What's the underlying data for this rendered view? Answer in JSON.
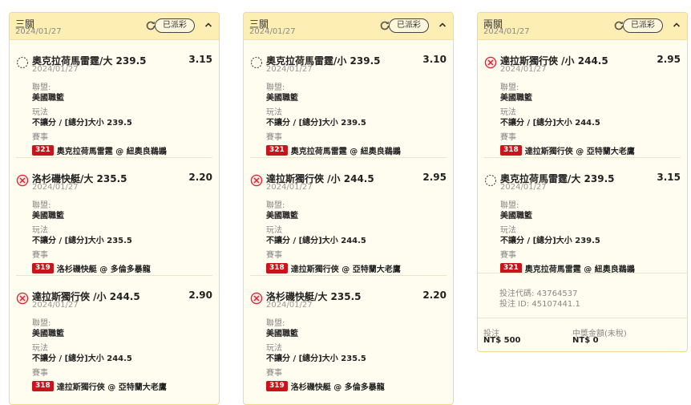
{
  "colors": {
    "accent": "#fdeeb4",
    "border": "#f3d989",
    "badge": "#c8141b",
    "lost": "#d9262b"
  },
  "labels": {
    "league": "聯盟:",
    "play": "玩法",
    "event": "賽事"
  },
  "tickets": [
    {
      "title": "三關",
      "date": "2024/01/27",
      "status": "已派彩",
      "legs": [
        {
          "result": "pending",
          "selection": "奧克拉荷馬雷霆/大 239.5",
          "odds": "3.15",
          "date": "2024/01/27",
          "league": "美國職籃",
          "play": "不讓分 / [總分]大小 239.5",
          "event_id": "321",
          "event_name": "奧克拉荷馬雷霆 @ 紐奧良鵜鶘"
        },
        {
          "result": "lost",
          "selection": "洛杉磯快艇/大 235.5",
          "odds": "2.20",
          "date": "2024/01/27",
          "league": "美國職籃",
          "play": "不讓分 / [總分]大小 235.5",
          "event_id": "319",
          "event_name": "洛杉磯快艇 @ 多倫多暴龍"
        },
        {
          "result": "lost",
          "selection": "達拉斯獨行俠 /小 244.5",
          "odds": "2.90",
          "date": "2024/01/27",
          "league": "美國職籃",
          "play": "不讓分 / [總分]大小 244.5",
          "event_id": "318",
          "event_name": "達拉斯獨行俠 @ 亞特蘭大老鷹"
        }
      ]
    },
    {
      "title": "三關",
      "date": "2024/01/27",
      "status": "已派彩",
      "legs": [
        {
          "result": "pending",
          "selection": "奧克拉荷馬雷霆/小 239.5",
          "odds": "3.10",
          "date": "2024/01/27",
          "league": "美國職籃",
          "play": "不讓分 / [總分]大小 239.5",
          "event_id": "321",
          "event_name": "奧克拉荷馬雷霆 @ 紐奧良鵜鶘"
        },
        {
          "result": "lost",
          "selection": "達拉斯獨行俠 /小 244.5",
          "odds": "2.95",
          "date": "2024/01/27",
          "league": "美國職籃",
          "play": "不讓分 / [總分]大小 244.5",
          "event_id": "318",
          "event_name": "達拉斯獨行俠 @ 亞特蘭大老鷹"
        },
        {
          "result": "lost",
          "selection": "洛杉磯快艇/大 235.5",
          "odds": "2.20",
          "date": "2024/01/27",
          "league": "美國職籃",
          "play": "不讓分 / [總分]大小 235.5",
          "event_id": "319",
          "event_name": "洛杉磯快艇 @ 多倫多暴龍"
        }
      ]
    },
    {
      "title": "兩關",
      "date": "2024/01/27",
      "status": "已派彩",
      "legs": [
        {
          "result": "lost",
          "selection": "達拉斯獨行俠 /小 244.5",
          "odds": "2.95",
          "date": "2024/01/27",
          "league": "美國職籃",
          "play": "不讓分 / [總分]大小 244.5",
          "event_id": "318",
          "event_name": "達拉斯獨行俠 @ 亞特蘭大老鷹"
        },
        {
          "result": "pending",
          "selection": "奧克拉荷馬雷霆/大 239.5",
          "odds": "3.15",
          "date": "2024/01/27",
          "league": "美國職籃",
          "play": "不讓分 / [總分]大小 239.5",
          "event_id": "321",
          "event_name": "奧克拉荷馬雷霆 @ 紐奧良鵜鶘"
        }
      ],
      "bet_code": "投注代碼: 43764537",
      "bet_id": "投注 ID: 45107441.1",
      "stake_label": "投注",
      "stake": "NT$ 500",
      "win_label": "中獎金額(未稅)",
      "win": "NT$ 0"
    }
  ]
}
